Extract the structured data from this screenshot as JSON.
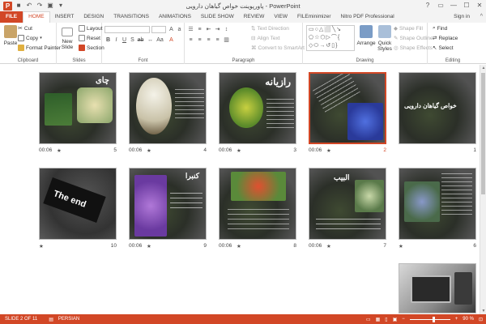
{
  "titlebar": {
    "title": "پاورپوینت خواص گیاهان دارویی - PowerPoint",
    "controls": [
      "?",
      "▭",
      "—",
      "☐",
      "✕"
    ]
  },
  "tabs": [
    {
      "label": "FILE",
      "kind": "file"
    },
    {
      "label": "HOME",
      "kind": "active"
    },
    {
      "label": "INSERT"
    },
    {
      "label": "DESIGN"
    },
    {
      "label": "TRANSITIONS"
    },
    {
      "label": "ANIMATIONS"
    },
    {
      "label": "SLIDE SHOW"
    },
    {
      "label": "REVIEW"
    },
    {
      "label": "VIEW"
    },
    {
      "label": "FILEminimizer"
    },
    {
      "label": "Nitro PDF Professional"
    }
  ],
  "signin": "Sign in",
  "ribbon": {
    "clipboard": {
      "label": "Clipboard",
      "paste": "Paste",
      "cut": "Cut",
      "copy": "Copy",
      "format_painter": "Format Painter"
    },
    "slides": {
      "label": "Slides",
      "new_slide": "New Slide",
      "layout": "Layout",
      "reset": "Reset",
      "section": "Section"
    },
    "font": {
      "label": "Font"
    },
    "paragraph": {
      "label": "Paragraph",
      "text_direction": "Text Direction",
      "align_text": "Align Text",
      "convert_smartart": "Convert to SmartArt"
    },
    "drawing": {
      "label": "Drawing",
      "arrange": "Arrange",
      "quick_styles": "Quick Styles",
      "shape_fill": "Shape Fill",
      "shape_outline": "Shape Outline",
      "shape_effects": "Shape Effects"
    },
    "editing": {
      "label": "Editing",
      "find": "Find",
      "replace": "Replace",
      "select": "Select"
    }
  },
  "slides": [
    {
      "num": "1",
      "time": "",
      "title": "خواص گیاهان دارویی",
      "body": ""
    },
    {
      "num": "2",
      "time": "00:06",
      "title": "",
      "body": "",
      "selected": true
    },
    {
      "num": "3",
      "time": "00:06",
      "title": "رازیانه",
      "body": ""
    },
    {
      "num": "4",
      "time": "00:06",
      "title": "",
      "body": ""
    },
    {
      "num": "5",
      "time": "00:06",
      "title": "چای",
      "body": ""
    },
    {
      "num": "6",
      "time": "",
      "title": "",
      "body": ""
    },
    {
      "num": "7",
      "time": "00:06",
      "title": "البیب",
      "body": ""
    },
    {
      "num": "8",
      "time": "00:06",
      "title": "",
      "body": ""
    },
    {
      "num": "9",
      "time": "00:06",
      "title": "کنبرا",
      "body": ""
    },
    {
      "num": "10",
      "time": "",
      "title": "The end",
      "body": ""
    },
    {
      "num": "11",
      "time": "",
      "title": "",
      "body": ""
    }
  ],
  "statusbar": {
    "slide": "SLIDE 2 OF 11",
    "language": "PERSIAN",
    "zoom": "90 %",
    "zoom_fraction": 0.6
  },
  "colors": {
    "accent": "#d24726",
    "ribbon_bg": "#ffffff",
    "tab_bg": "#f3f3f3"
  }
}
